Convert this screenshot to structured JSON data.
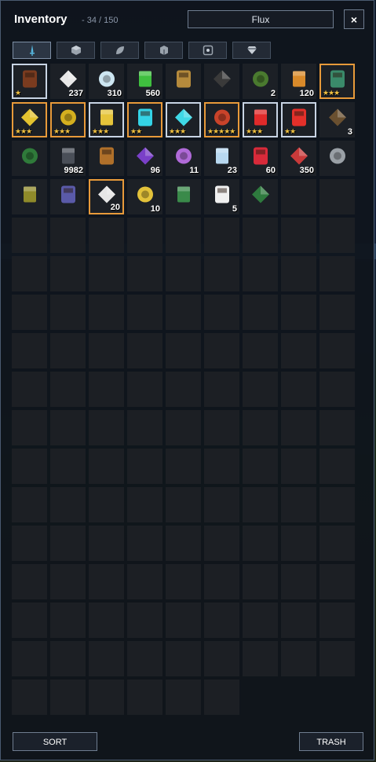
{
  "header": {
    "title": "Inventory",
    "count": "- 34 / 150",
    "search_value": "Flux",
    "close_label": "×"
  },
  "tabs": [
    {
      "name": "weapons",
      "icon": "sword-icon",
      "active": true
    },
    {
      "name": "blocks",
      "icon": "block-icon",
      "active": false
    },
    {
      "name": "materials",
      "icon": "leaf-icon",
      "active": false
    },
    {
      "name": "costumes",
      "icon": "cube-icon",
      "active": false
    },
    {
      "name": "gems",
      "icon": "socket-icon",
      "active": false
    },
    {
      "name": "special",
      "icon": "diamond-icon",
      "active": false
    }
  ],
  "items": [
    {
      "name": "backpack",
      "qty": "",
      "rarity": "rare",
      "stars": "★",
      "color": "#7a3b1f"
    },
    {
      "name": "cake",
      "qty": "237",
      "rarity": "",
      "stars": "",
      "color": "#e8e8e8"
    },
    {
      "name": "ice-crystals",
      "qty": "310",
      "rarity": "",
      "stars": "",
      "color": "#cde6f2"
    },
    {
      "name": "vine",
      "qty": "560",
      "rarity": "",
      "stars": "",
      "color": "#3fbf3f"
    },
    {
      "name": "trophy",
      "qty": "",
      "rarity": "",
      "stars": "",
      "color": "#b58a3c"
    },
    {
      "name": "bow-tie",
      "qty": "",
      "rarity": "",
      "stars": "",
      "color": "#3a3a3a"
    },
    {
      "name": "mount",
      "qty": "2",
      "rarity": "",
      "stars": "",
      "color": "#4a7a2f"
    },
    {
      "name": "glider",
      "qty": "120",
      "rarity": "",
      "stars": "",
      "color": "#d98a2a"
    },
    {
      "name": "dragon-egg",
      "qty": "",
      "rarity": "epic",
      "stars": "★★★",
      "color": "#3a8a6a"
    },
    {
      "name": "gold-mask",
      "qty": "",
      "rarity": "epic",
      "stars": "★★★",
      "color": "#e3c22f"
    },
    {
      "name": "gold-helmet",
      "qty": "",
      "rarity": "epic",
      "stars": "★★★",
      "color": "#d4af1f"
    },
    {
      "name": "gold-armor",
      "qty": "",
      "rarity": "rare",
      "stars": "★★★",
      "color": "#e6c43a"
    },
    {
      "name": "cyan-flag",
      "qty": "",
      "rarity": "epic",
      "stars": "★★",
      "color": "#34d3e6"
    },
    {
      "name": "cyan-helmet",
      "qty": "",
      "rarity": "rare",
      "stars": "★★★",
      "color": "#3fd9e6"
    },
    {
      "name": "red-shield",
      "qty": "",
      "rarity": "epic",
      "stars": "★★★★★",
      "color": "#c9432a"
    },
    {
      "name": "red-helmet",
      "qty": "",
      "rarity": "rare",
      "stars": "★★★",
      "color": "#e02a2a"
    },
    {
      "name": "red-armor",
      "qty": "",
      "rarity": "rare",
      "stars": "★★",
      "color": "#e3302a"
    },
    {
      "name": "staff",
      "qty": "3",
      "rarity": "",
      "stars": "",
      "color": "#6a5030"
    },
    {
      "name": "wand",
      "qty": "",
      "rarity": "",
      "stars": "",
      "color": "#2f7a3a"
    },
    {
      "name": "ore",
      "qty": "9982",
      "rarity": "",
      "stars": "",
      "color": "#4a4f58"
    },
    {
      "name": "portal-ring",
      "qty": "",
      "rarity": "",
      "stars": "",
      "color": "#b0702a"
    },
    {
      "name": "purple-key",
      "qty": "96",
      "rarity": "",
      "stars": "",
      "color": "#7a40c8"
    },
    {
      "name": "shards",
      "qty": "11",
      "rarity": "",
      "stars": "",
      "color": "#b06ad8"
    },
    {
      "name": "crystal-key",
      "qty": "23",
      "rarity": "",
      "stars": "",
      "color": "#b8d8f0"
    },
    {
      "name": "potion",
      "qty": "60",
      "rarity": "",
      "stars": "",
      "color": "#d82a3a"
    },
    {
      "name": "flask",
      "qty": "350",
      "rarity": "",
      "stars": "",
      "color": "#c93a3a"
    },
    {
      "name": "barrel",
      "qty": "",
      "rarity": "",
      "stars": "",
      "color": "#9aa0a6"
    },
    {
      "name": "gold-key",
      "qty": "",
      "rarity": "",
      "stars": "",
      "color": "#8f8a2a"
    },
    {
      "name": "rune-stone",
      "qty": "",
      "rarity": "",
      "stars": "",
      "color": "#5a5aa8"
    },
    {
      "name": "trophy-parts",
      "qty": "20",
      "rarity": "epic",
      "stars": "",
      "color": "#e6e6e6"
    },
    {
      "name": "yellow-chest",
      "qty": "10",
      "rarity": "",
      "stars": "",
      "color": "#e3c23a"
    },
    {
      "name": "green-lamp",
      "qty": "",
      "rarity": "",
      "stars": "",
      "color": "#3a8a4a"
    },
    {
      "name": "cloud-flower",
      "qty": "5",
      "rarity": "",
      "stars": "",
      "color": "#f0f0f0"
    },
    {
      "name": "clover",
      "qty": "",
      "rarity": "",
      "stars": "",
      "color": "#2e7a3e"
    }
  ],
  "buttons": {
    "sort": "SORT",
    "trash": "TRASH"
  }
}
